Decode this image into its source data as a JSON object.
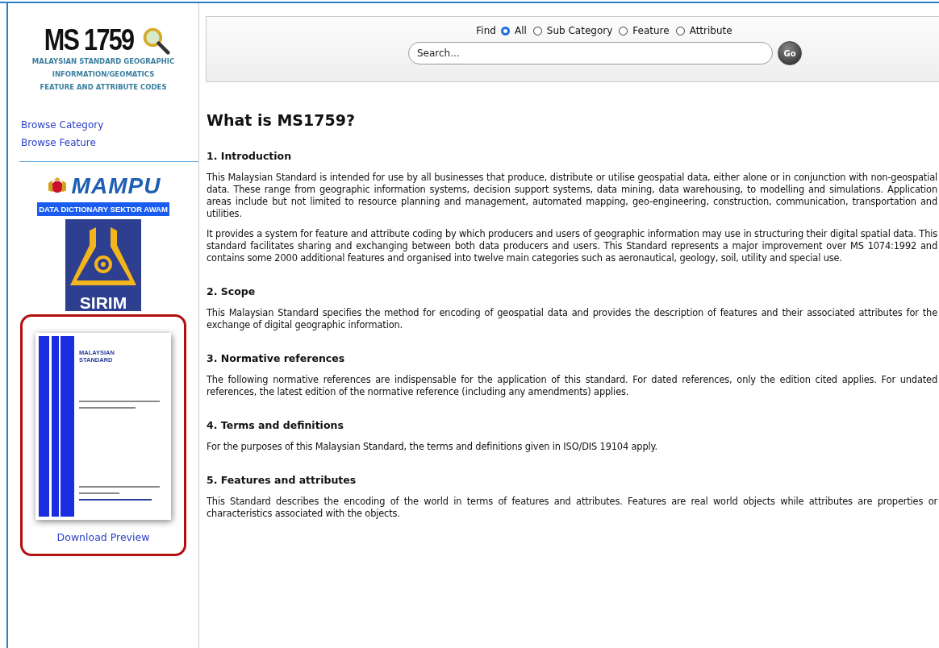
{
  "sidebar": {
    "logo": {
      "title": "MS 1759",
      "subtitle_lines": [
        "MALAYSIAN STANDARD GEOGRAPHIC",
        "INFORMATION/GEOMATICS",
        "FEATURE AND ATTRIBUTE CODES"
      ]
    },
    "links": [
      "Browse Category",
      "Browse Feature"
    ],
    "partners": [
      {
        "kind": "mampu",
        "name": "MAMPU",
        "caption": "DATA DICTIONARY SEKTOR AWAM"
      },
      {
        "kind": "sirim",
        "name": "SIRIM"
      }
    ],
    "preview": {
      "cover_heading": "MALAYSIAN STANDARD",
      "link": "Download Preview"
    }
  },
  "search": {
    "label": "Find",
    "options": [
      {
        "label": "All",
        "selected": true
      },
      {
        "label": "Sub Category",
        "selected": false
      },
      {
        "label": "Feature",
        "selected": false
      },
      {
        "label": "Attribute",
        "selected": false
      }
    ],
    "placeholder": "Search...",
    "button": "Go"
  },
  "page": {
    "title": "What is MS1759?",
    "sections": [
      {
        "heading": "1. Introduction",
        "paragraphs": [
          "This Malaysian Standard is intended for use by all businesses that produce, distribute or utilise geospatial data, either alone or in conjunction with non-geospatial data. These range from geographic information systems, decision support systems, data mining, data warehousing, to modelling and simulations. Application areas include but not limited to resource planning and management, automated mapping, geo-engineering, construction, communication, transportation and utilities.",
          "It provides a system for feature and attribute coding by which producers and users of geographic information may use in structuring their digital spatial data. This standard facilitates sharing and exchanging between both data producers and users. This Standard represents a major improvement over MS 1074:1992 and contains some 2000 additional features and organised into twelve main categories such as aeronautical, geology, soil, utility and special use."
        ]
      },
      {
        "heading": "2. Scope",
        "paragraphs": [
          "This Malaysian Standard specifies the method for encoding of geospatial data and provides the description of features and their associated attributes for the exchange of digital geographic information."
        ]
      },
      {
        "heading": "3. Normative references",
        "paragraphs": [
          "The following normative references are indispensable for the application of this standard. For dated references, only the edition cited applies. For undated references, the latest edition of the normative reference (including any amendments) applies."
        ]
      },
      {
        "heading": "4. Terms and definitions",
        "paragraphs": [
          "For the purposes of this Malaysian Standard, the terms and definitions given in ISO/DIS 19104 apply."
        ]
      },
      {
        "heading": "5. Features and attributes",
        "paragraphs": [
          "This Standard describes the encoding of the world in terms of features and attributes. Features are real world objects while attributes are properties or characteristics associated with the objects."
        ]
      }
    ]
  }
}
